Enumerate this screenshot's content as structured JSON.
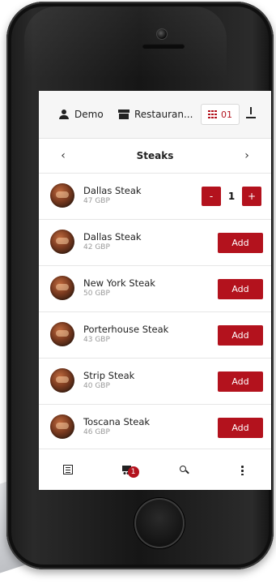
{
  "topbar": {
    "user_label": "Demo",
    "restaurant_label": "Restauran...",
    "table_number": "01"
  },
  "category": {
    "title": "Steaks",
    "prev_glyph": "‹",
    "next_glyph": "›"
  },
  "items": [
    {
      "name": "Dallas Steak",
      "price": "47 GBP",
      "quantity": "1",
      "in_cart": true
    },
    {
      "name": "Dallas Steak",
      "price": "42 GBP",
      "add_label": "Add"
    },
    {
      "name": "New York Steak",
      "price": "50 GBP",
      "add_label": "Add"
    },
    {
      "name": "Porterhouse Steak",
      "price": "43 GBP",
      "add_label": "Add"
    },
    {
      "name": "Strip Steak",
      "price": "40 GBP",
      "add_label": "Add"
    },
    {
      "name": "Toscana Steak",
      "price": "46 GBP",
      "add_label": "Add"
    }
  ],
  "stepper": {
    "minus": "-",
    "plus": "+"
  },
  "bottom_nav": {
    "cart_badge": "1",
    "icons": [
      "menu-list-icon",
      "cart-icon",
      "search-icon",
      "more-icon"
    ]
  },
  "colors": {
    "accent": "#b3121d"
  }
}
